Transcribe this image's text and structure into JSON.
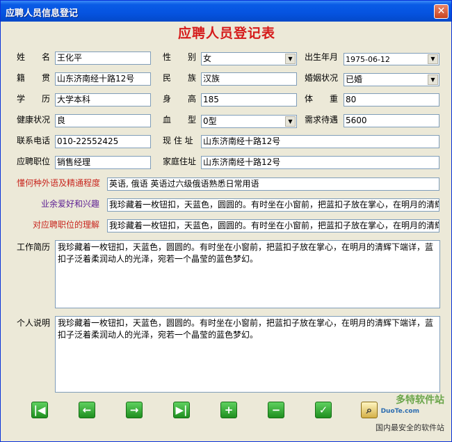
{
  "window": {
    "title": "应聘人员信息登记",
    "close_glyph": "✕"
  },
  "form_title": "应聘人员登记表",
  "fields": {
    "name": {
      "label_a": "姓",
      "label_b": "名",
      "value": "王化平"
    },
    "gender": {
      "label_a": "性",
      "label_b": "别",
      "value": "女"
    },
    "birth": {
      "label": "出生年月",
      "value": "1975-06-12"
    },
    "native": {
      "label_a": "籍",
      "label_b": "贯",
      "value": "山东济南经十路12号"
    },
    "ethnic": {
      "label_a": "民",
      "label_b": "族",
      "value": "汉族"
    },
    "marital": {
      "label": "婚姻状况",
      "value": "已婚"
    },
    "education": {
      "label_a": "学",
      "label_b": "历",
      "value": "大学本科"
    },
    "height": {
      "label_a": "身",
      "label_b": "高",
      "value": "185"
    },
    "weight": {
      "label_a": "体",
      "label_b": "重",
      "value": "80"
    },
    "health": {
      "label": "健康状况",
      "value": "良"
    },
    "blood": {
      "label_a": "血",
      "label_b": "型",
      "value": "0型"
    },
    "salary": {
      "label": "需求待遇",
      "value": "5600"
    },
    "phone": {
      "label": "联系电话",
      "value": "010-22552425"
    },
    "address": {
      "label": "现 住 址",
      "value": "山东济南经十路12号"
    },
    "position": {
      "label": "应聘职位",
      "value": "销售经理"
    },
    "home": {
      "label": "家庭住址",
      "value": "山东济南经十路12号"
    },
    "languages": {
      "label": "懂何种外语及精通程度",
      "value": "英语, 俄语   英语过六级俄语熟悉日常用语"
    },
    "hobbies": {
      "label": "业余爱好和兴趣",
      "value": "我珍藏着一枚钮扣，天蓝色，圆圆的。有时坐在小窗前，把蓝扣子放在掌心，在明月的清辉"
    },
    "understanding": {
      "label": "对应聘职位的理解",
      "value": "我珍藏着一枚钮扣，天蓝色，圆圆的。有时坐在小窗前，把蓝扣子放在掌心，在明月的清辉"
    },
    "resume": {
      "label": "工作简历",
      "line1": "我珍藏着一枚钮扣，天蓝色，圆圆的。有时坐在小窗前，把蓝扣子放在掌心，在明月的清辉下端详，蓝",
      "line2": "扣子泛着柔润动人的光泽，宛若一个晶莹的蓝色梦幻。"
    },
    "statement": {
      "label": "个人说明",
      "line1": "我珍藏着一枚钮扣，天蓝色，圆圆的。有时坐在小窗前，把蓝扣子放在掌心，在明月的清辉下端详，蓝",
      "line2": "扣子泛着柔润动人的光泽，宛若一个晶莹的蓝色梦幻。"
    }
  },
  "dropdown_glyph": "▼",
  "nav": {
    "first": "|◀",
    "prev": "←",
    "next": "→",
    "last": "▶|",
    "add": "+",
    "remove": "−",
    "confirm": "✓",
    "search": "⌕"
  },
  "watermark": {
    "brand": "多特软件站",
    "domain": "DuoTe.com",
    "sub": "国内最安全的软件站"
  }
}
